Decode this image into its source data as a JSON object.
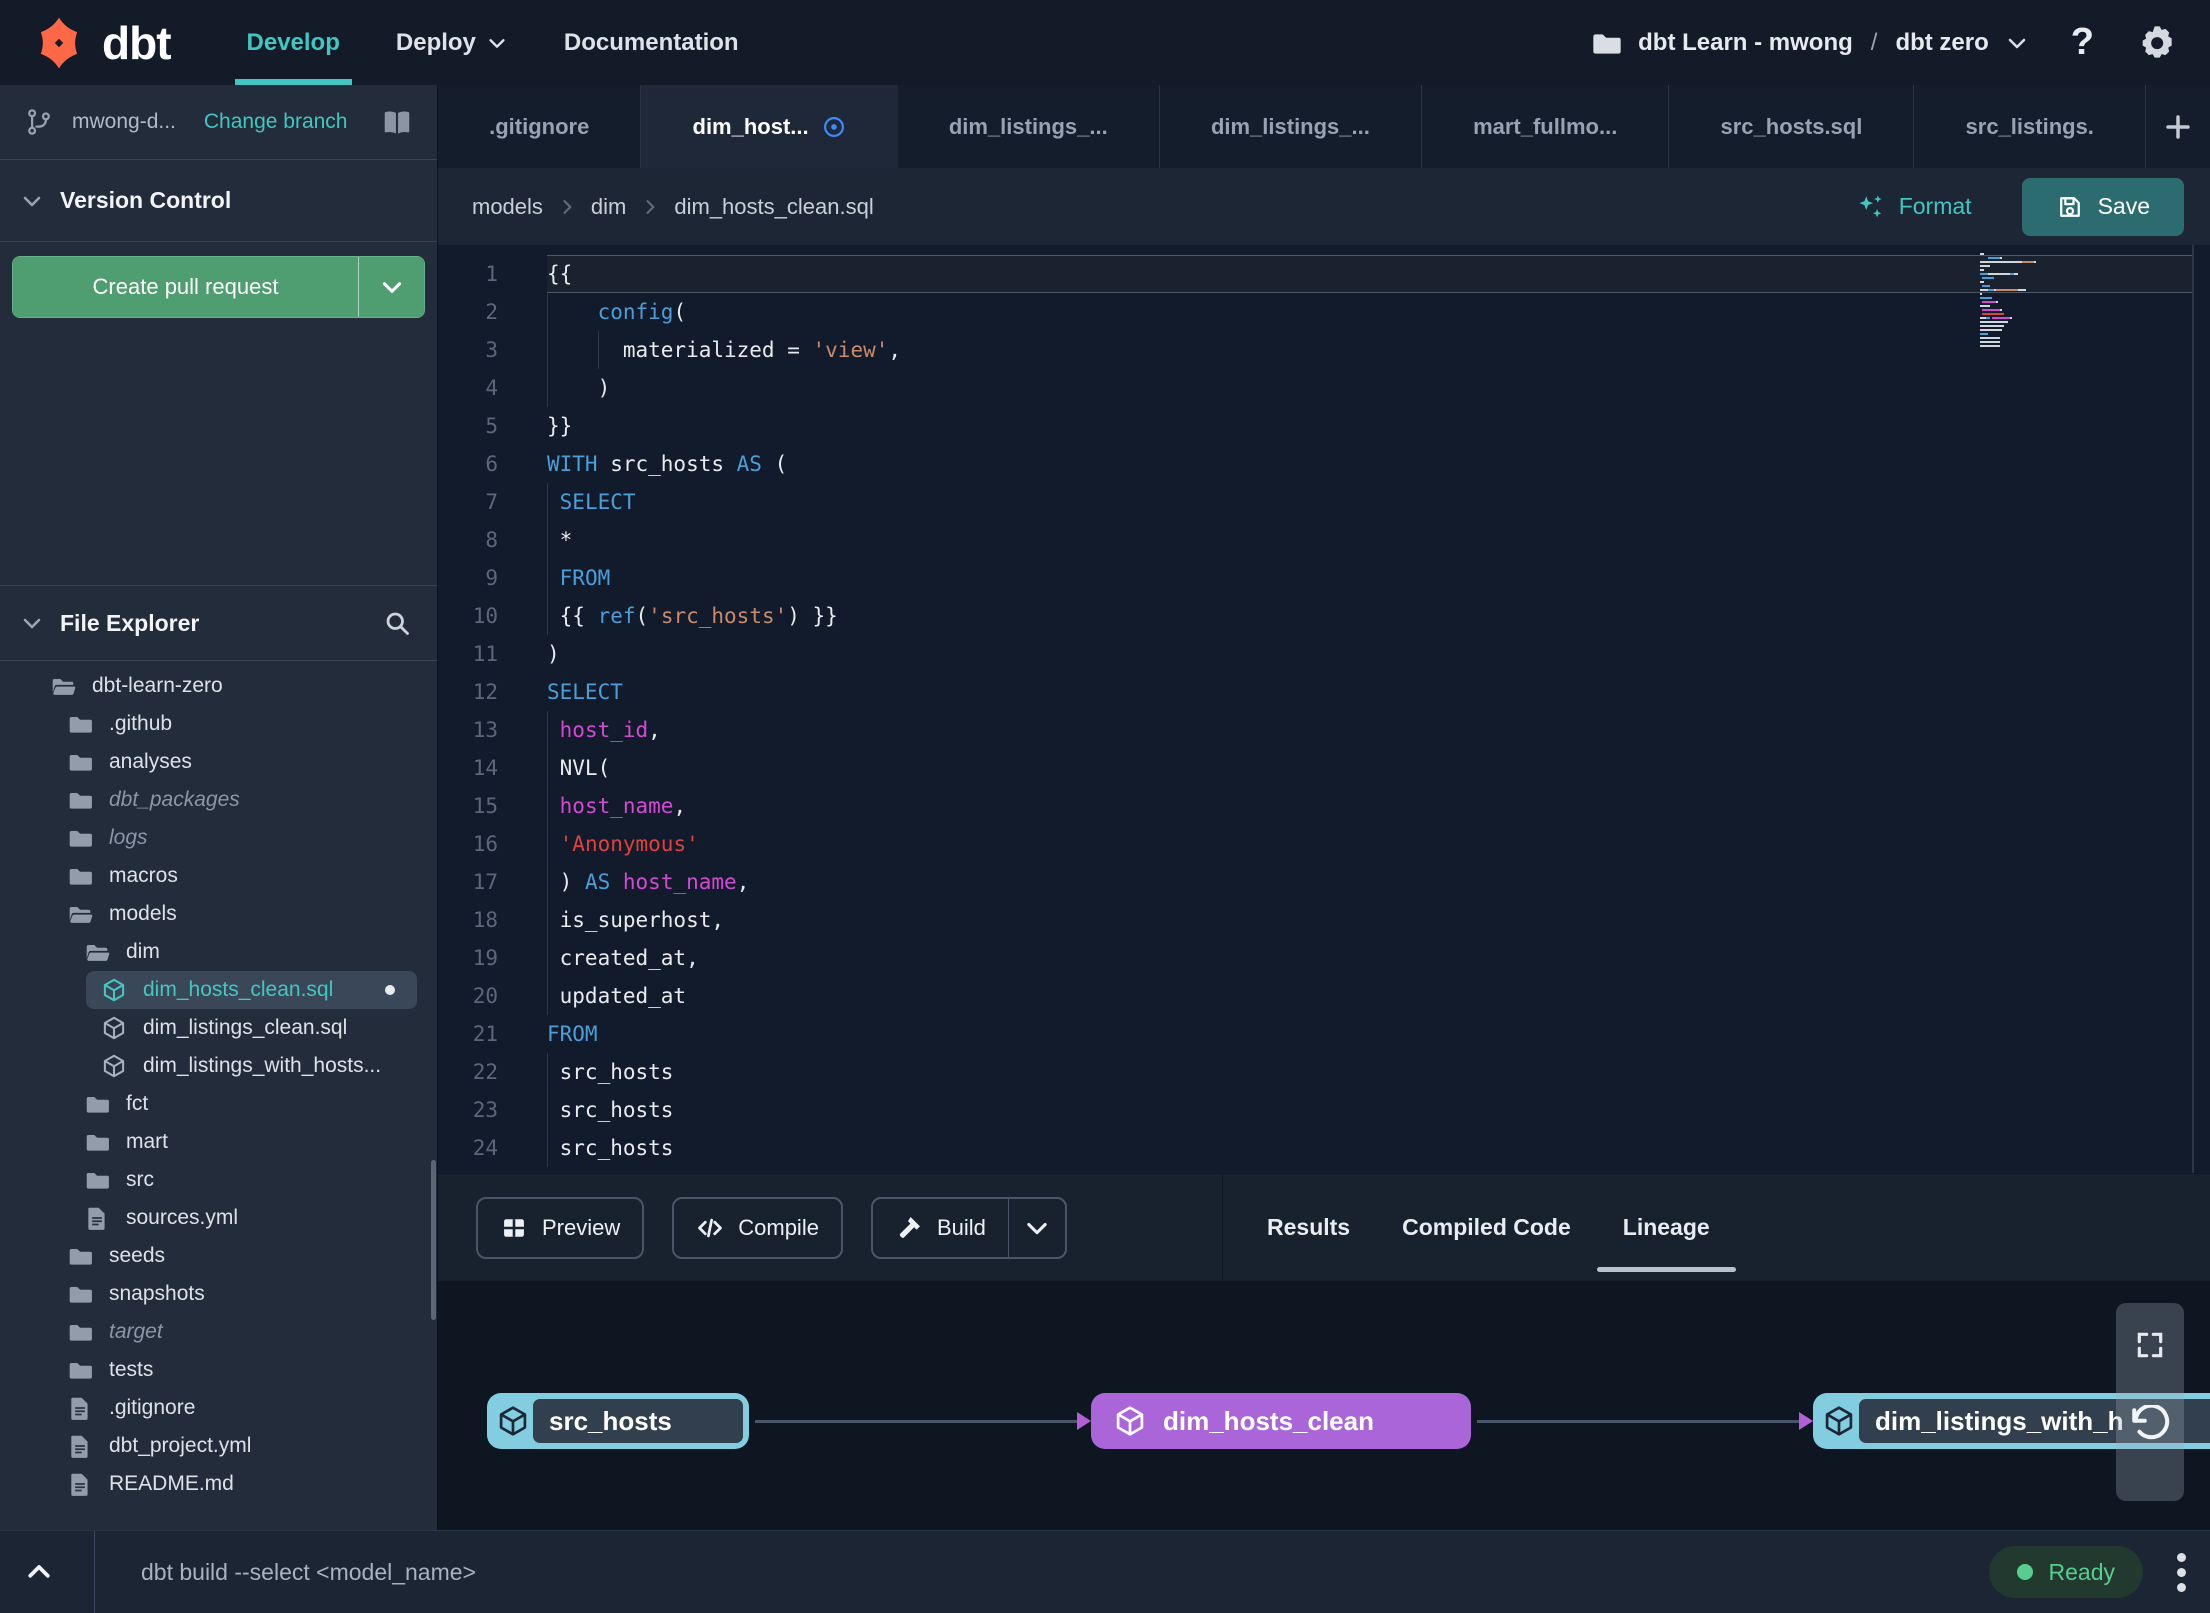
{
  "navbar": {
    "logo_text": "dbt",
    "nav_items": [
      {
        "label": "Develop",
        "active": true,
        "caret": false
      },
      {
        "label": "Deploy",
        "active": false,
        "caret": true
      },
      {
        "label": "Documentation",
        "active": false,
        "caret": false
      }
    ],
    "account_label": "dbt Learn - mwong",
    "path_separator": "/",
    "project_label": "dbt zero",
    "help_glyph": "?"
  },
  "sidebar": {
    "branch_name": "mwong-d...",
    "change_branch_label": "Change branch",
    "version_control_label": "Version Control",
    "create_pr_label": "Create pull request",
    "file_explorer_label": "File Explorer",
    "tree": [
      {
        "label": "dbt-learn-zero",
        "icon": "folder-open",
        "indent": 0
      },
      {
        "label": ".github",
        "icon": "folder",
        "indent": 1
      },
      {
        "label": "analyses",
        "icon": "folder",
        "indent": 1
      },
      {
        "label": "dbt_packages",
        "icon": "folder",
        "indent": 1,
        "italic": true
      },
      {
        "label": "logs",
        "icon": "folder",
        "indent": 1,
        "italic": true
      },
      {
        "label": "macros",
        "icon": "folder",
        "indent": 1
      },
      {
        "label": "models",
        "icon": "folder-open",
        "indent": 1
      },
      {
        "label": "dim",
        "icon": "folder-open",
        "indent": 2
      },
      {
        "label": "dim_hosts_clean.sql",
        "icon": "model",
        "indent": 3,
        "selected": true,
        "modified": true
      },
      {
        "label": "dim_listings_clean.sql",
        "icon": "model",
        "indent": 3
      },
      {
        "label": "dim_listings_with_hosts...",
        "icon": "model",
        "indent": 3
      },
      {
        "label": "fct",
        "icon": "folder",
        "indent": 2
      },
      {
        "label": "mart",
        "icon": "folder",
        "indent": 2
      },
      {
        "label": "src",
        "icon": "folder",
        "indent": 2
      },
      {
        "label": "sources.yml",
        "icon": "file",
        "indent": 2
      },
      {
        "label": "seeds",
        "icon": "folder",
        "indent": 1
      },
      {
        "label": "snapshots",
        "icon": "folder",
        "indent": 1
      },
      {
        "label": "target",
        "icon": "folder",
        "indent": 1,
        "italic": true
      },
      {
        "label": "tests",
        "icon": "folder",
        "indent": 1
      },
      {
        "label": ".gitignore",
        "icon": "file",
        "indent": 1
      },
      {
        "label": "dbt_project.yml",
        "icon": "file",
        "indent": 1
      },
      {
        "label": "README.md",
        "icon": "file",
        "indent": 1
      }
    ]
  },
  "tabs": [
    {
      "label": ".gitignore",
      "active": false,
      "modified": false
    },
    {
      "label": "dim_host...",
      "active": true,
      "modified": true
    },
    {
      "label": "dim_listings_...",
      "active": false,
      "modified": false
    },
    {
      "label": "dim_listings_...",
      "active": false,
      "modified": false
    },
    {
      "label": "mart_fullmo...",
      "active": false,
      "modified": false
    },
    {
      "label": "src_hosts.sql",
      "active": false,
      "modified": false
    },
    {
      "label": "src_listings.",
      "active": false,
      "modified": false
    }
  ],
  "editor_header": {
    "breadcrumb": [
      "models",
      "dim",
      "dim_hosts_clean.sql"
    ],
    "format_label": "Format",
    "save_label": "Save"
  },
  "editor": {
    "lines": [
      {
        "n": 1,
        "hl": true,
        "seg": [
          [
            "{{",
            "p"
          ]
        ]
      },
      {
        "n": 2,
        "g": [
          0
        ],
        "seg": [
          [
            "    ",
            "p"
          ],
          [
            "config",
            "k"
          ],
          [
            "(",
            "p"
          ]
        ]
      },
      {
        "n": 3,
        "g": [
          0,
          4
        ],
        "seg": [
          [
            "      materialized = ",
            "p"
          ],
          [
            "'view'",
            "s"
          ],
          [
            ",",
            "p"
          ]
        ]
      },
      {
        "n": 4,
        "g": [
          0
        ],
        "seg": [
          [
            "    )",
            "p"
          ]
        ]
      },
      {
        "n": 5,
        "seg": [
          [
            "}}",
            "p"
          ]
        ]
      },
      {
        "n": 6,
        "seg": [
          [
            "WITH",
            "k"
          ],
          [
            " src_hosts ",
            "p"
          ],
          [
            "AS",
            "k"
          ],
          [
            " (",
            "p"
          ]
        ]
      },
      {
        "n": 7,
        "g": [
          0
        ],
        "seg": [
          [
            " ",
            "p"
          ],
          [
            "SELECT",
            "k"
          ]
        ]
      },
      {
        "n": 8,
        "g": [
          0
        ],
        "seg": [
          [
            " *",
            "p"
          ]
        ]
      },
      {
        "n": 9,
        "g": [
          0
        ],
        "seg": [
          [
            " ",
            "p"
          ],
          [
            "FROM",
            "k"
          ]
        ]
      },
      {
        "n": 10,
        "g": [
          0
        ],
        "seg": [
          [
            " {{ ",
            "p"
          ],
          [
            "ref",
            "k"
          ],
          [
            "(",
            "p"
          ],
          [
            "'src_hosts'",
            "s"
          ],
          [
            ") }}",
            "p"
          ]
        ]
      },
      {
        "n": 11,
        "seg": [
          [
            ")",
            "p"
          ]
        ]
      },
      {
        "n": 12,
        "seg": [
          [
            "SELECT",
            "k"
          ]
        ]
      },
      {
        "n": 13,
        "g": [
          0
        ],
        "seg": [
          [
            " ",
            "p"
          ],
          [
            "host_id",
            "m"
          ],
          [
            ",",
            "p"
          ]
        ]
      },
      {
        "n": 14,
        "g": [
          0
        ],
        "seg": [
          [
            " NVL(",
            "p"
          ]
        ]
      },
      {
        "n": 15,
        "g": [
          0
        ],
        "seg": [
          [
            " ",
            "p"
          ],
          [
            "host_name",
            "m"
          ],
          [
            ",",
            "p"
          ]
        ]
      },
      {
        "n": 16,
        "g": [
          0
        ],
        "seg": [
          [
            " ",
            "p"
          ],
          [
            "'Anonymous'",
            "r"
          ]
        ]
      },
      {
        "n": 17,
        "g": [
          0
        ],
        "seg": [
          [
            " ) ",
            "p"
          ],
          [
            "AS",
            "k"
          ],
          [
            " ",
            "p"
          ],
          [
            "host_name",
            "m"
          ],
          [
            ",",
            "p"
          ]
        ]
      },
      {
        "n": 18,
        "g": [
          0
        ],
        "seg": [
          [
            " is_superhost,",
            "p"
          ]
        ]
      },
      {
        "n": 19,
        "g": [
          0
        ],
        "seg": [
          [
            " created_at,",
            "p"
          ]
        ]
      },
      {
        "n": 20,
        "g": [
          0
        ],
        "seg": [
          [
            " updated_at",
            "p"
          ]
        ]
      },
      {
        "n": 21,
        "seg": [
          [
            "FROM",
            "k"
          ]
        ]
      },
      {
        "n": 22,
        "g": [
          0
        ],
        "seg": [
          [
            " src_hosts",
            "p"
          ]
        ]
      },
      {
        "n": 23,
        "g": [
          0
        ],
        "seg": [
          [
            " src_hosts",
            "p"
          ]
        ]
      },
      {
        "n": 24,
        "g": [
          0
        ],
        "seg": [
          [
            " src_hosts",
            "p"
          ]
        ]
      }
    ]
  },
  "bottom_panel": {
    "buttons": [
      {
        "label": "Preview",
        "icon": "grid",
        "split": false
      },
      {
        "label": "Compile",
        "icon": "code",
        "split": false
      },
      {
        "label": "Build",
        "icon": "hammer",
        "split": true
      }
    ],
    "tabs": [
      {
        "label": "Results",
        "active": false
      },
      {
        "label": "Compiled Code",
        "active": false
      },
      {
        "label": "Lineage",
        "active": true
      }
    ]
  },
  "lineage": {
    "nodes": [
      {
        "label": "src_hosts",
        "variant": "cyan"
      },
      {
        "label": "dim_hosts_clean",
        "variant": "purple"
      },
      {
        "label": "dim_listings_with_h",
        "variant": "cyan"
      }
    ]
  },
  "statusbar": {
    "command": "dbt build --select <model_name>",
    "ready_label": "Ready"
  }
}
